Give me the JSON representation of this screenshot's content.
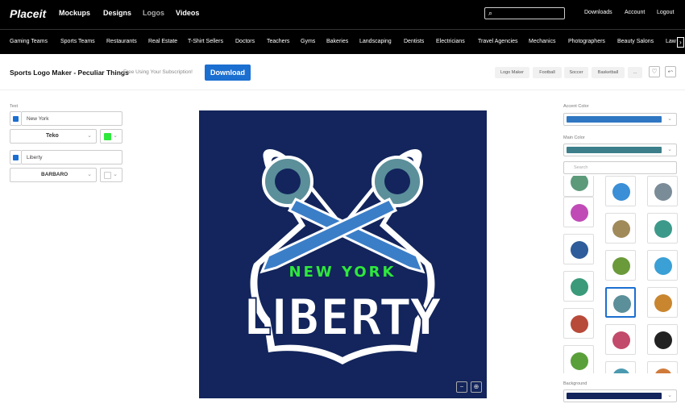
{
  "topbar": {
    "logo": "Placeit",
    "nav": [
      "Mockups",
      "Designs",
      "Logos",
      "Videos"
    ],
    "right": [
      "Downloads",
      "Account",
      "Logout"
    ]
  },
  "categories": [
    "Gaming Teams",
    "Sports Teams",
    "Restaurants",
    "Real Estate",
    "T-Shirt Sellers",
    "Doctors",
    "Teachers",
    "Gyms",
    "Bakeries",
    "Landscaping",
    "Dentists",
    "Electricians",
    "Travel Agencies",
    "Mechanics",
    "Photographers",
    "Beauty Salons",
    "Law"
  ],
  "header": {
    "title": "Sports Logo Maker - Peculiar Things",
    "subtitle": "Free Using Your Subscription!",
    "download": "Download",
    "tags": [
      "Logo Maker",
      "Football",
      "Soccer",
      "Basketball",
      "..."
    ]
  },
  "left": {
    "text_label": "Text",
    "line1": {
      "value": "New York",
      "font": "Teko",
      "color": "#2ee83c"
    },
    "line2": {
      "value": "Liberty",
      "font": "BARBARO",
      "color": "#ffffff"
    }
  },
  "logo": {
    "top_text": "NEW YORK",
    "main_text": "LIBERTY"
  },
  "right": {
    "accent_label": "Accent Color",
    "accent_color": "#2f77c2",
    "main_label": "Main Color",
    "main_color": "#3c7f8a",
    "search_placeholder": "Search",
    "background_label": "Background",
    "background_color": "#13255c"
  },
  "icons": [
    "car-icon",
    "helmet-icon",
    "bell-icon",
    "truck-icon",
    "knight-icon",
    "pistons-icon",
    "cannon-icon",
    "jet-icon",
    "rocket-icon",
    "gear-icon",
    "swords-icon",
    "burger-icon",
    "hotdog-icon",
    "fish-icon",
    "top-hat-icon",
    "pickle-icon",
    "arrow-icon",
    "food-icon"
  ],
  "colors": {
    "brand": "#1b6fd0",
    "topbar": "#000000"
  }
}
